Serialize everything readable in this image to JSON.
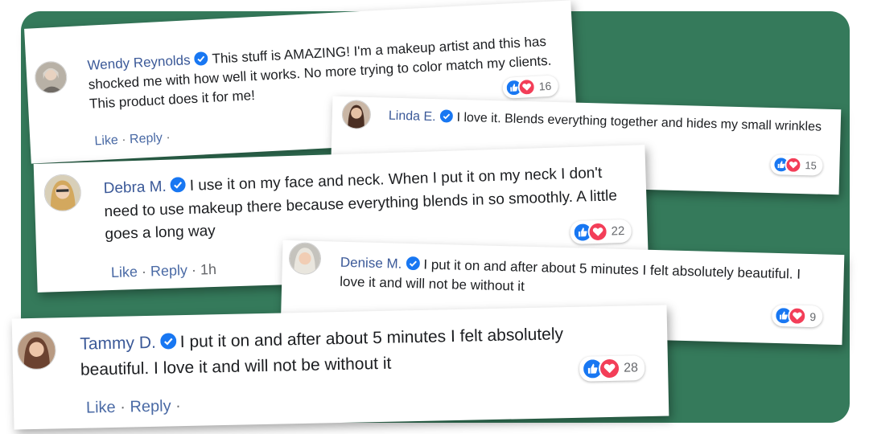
{
  "comments": [
    {
      "name": "Wendy Reynolds",
      "text": "This stuff is AMAZING! I'm a makeup artist and this has shocked me with how well it works. No more trying to color match my clients. This product does it for me!",
      "actions": [
        "Like",
        "Reply"
      ],
      "time": "",
      "reaction_count": "16"
    },
    {
      "name": "Linda E.",
      "text": "I love it. Blends everything together and hides my small wrinkles",
      "actions": [],
      "time": "",
      "reaction_count": "15"
    },
    {
      "name": "Debra M.",
      "text": "I use it on my face and neck. When I put it on my neck I don't need to use makeup there because everything blends in so smoothly. A little goes a long way",
      "actions": [
        "Like",
        "Reply"
      ],
      "time": "1h",
      "reaction_count": "22"
    },
    {
      "name": "Denise M.",
      "text": "I put it on and after about 5 minutes I felt absolutely beautiful. I love it and will not be without it",
      "actions": [],
      "time": "",
      "reaction_count": "9"
    },
    {
      "name": "Tammy D.",
      "text": "I put it on and after about 5 minutes I felt absolutely beautiful. I love it and will not be without it",
      "actions": [
        "Like",
        "Reply"
      ],
      "time": "",
      "reaction_count": "28"
    }
  ],
  "colors": {
    "background": "#357a5b",
    "name": "#3b5998",
    "like_blue": "#1877f2",
    "love_red": "#f33e58",
    "verified": "#1877f2"
  },
  "icons": [
    "verified-badge-icon",
    "like-reaction-icon",
    "love-reaction-icon"
  ]
}
